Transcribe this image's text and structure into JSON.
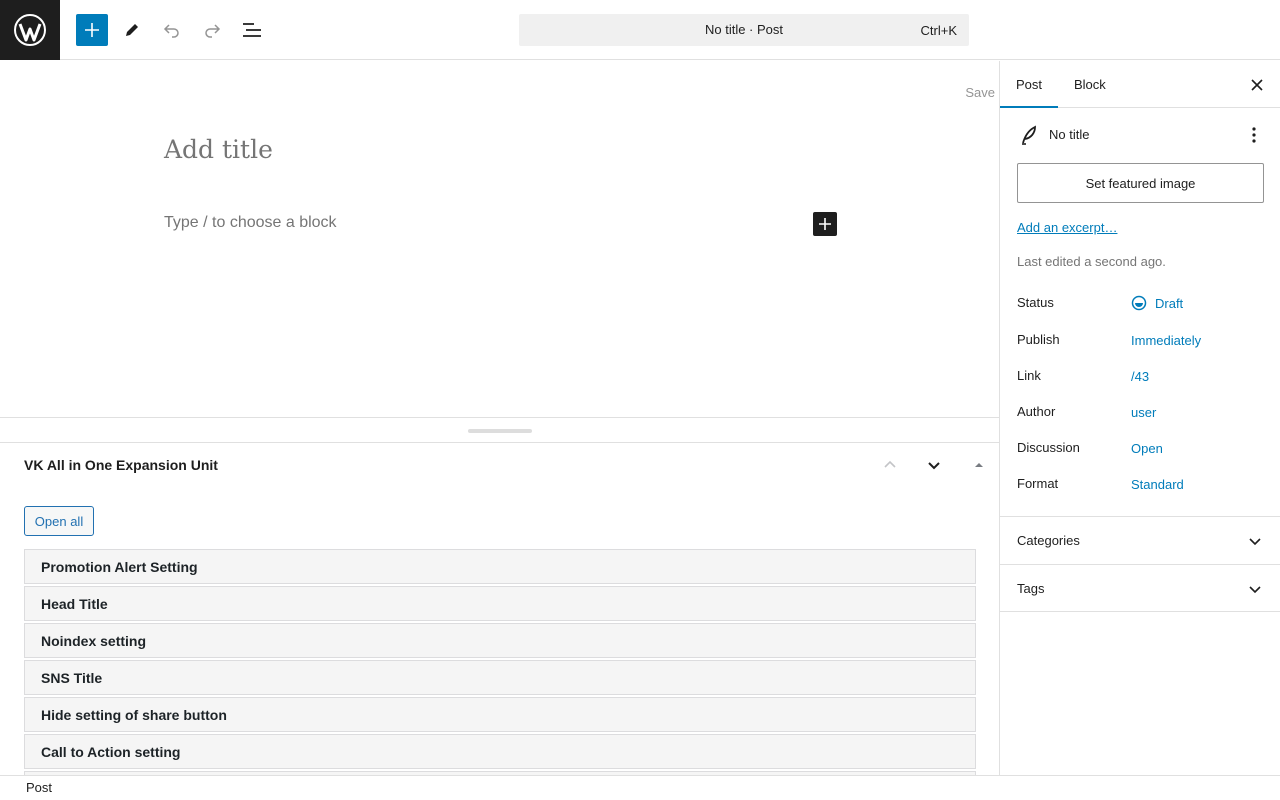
{
  "topbar": {
    "document_title": "No title · Post",
    "shortcut": "Ctrl+K",
    "icons": [
      "wordpress-logo-icon",
      "plus-icon",
      "pencil-icon",
      "undo-icon",
      "redo-icon",
      "list-view-icon"
    ]
  },
  "editor": {
    "save_label": "Save",
    "title_placeholder": "Add title",
    "block_placeholder": "Type / to choose a block"
  },
  "metabox": {
    "title": "VK All in One Expansion Unit",
    "open_all_label": "Open all",
    "sections": [
      "Promotion Alert Setting",
      "Head Title",
      "Noindex setting",
      "SNS Title",
      "Hide setting of share button",
      "Call to Action setting"
    ]
  },
  "footer": {
    "breadcrumb": "Post"
  },
  "sidebar": {
    "tabs": [
      "Post",
      "Block"
    ],
    "post_title": "No title",
    "featured_image_label": "Set featured image",
    "excerpt_link": "Add an excerpt…",
    "last_edited": "Last edited a second ago.",
    "rows": [
      {
        "label": "Status",
        "value": "Draft"
      },
      {
        "label": "Publish",
        "value": "Immediately"
      },
      {
        "label": "Link",
        "value": "/43"
      },
      {
        "label": "Author",
        "value": "user"
      },
      {
        "label": "Discussion",
        "value": "Open"
      },
      {
        "label": "Format",
        "value": "Standard"
      }
    ],
    "panels": [
      "Categories",
      "Tags"
    ]
  },
  "colors": {
    "accent": "#007cba",
    "dark": "#1e1e1e",
    "border": "#e0e0e0"
  }
}
